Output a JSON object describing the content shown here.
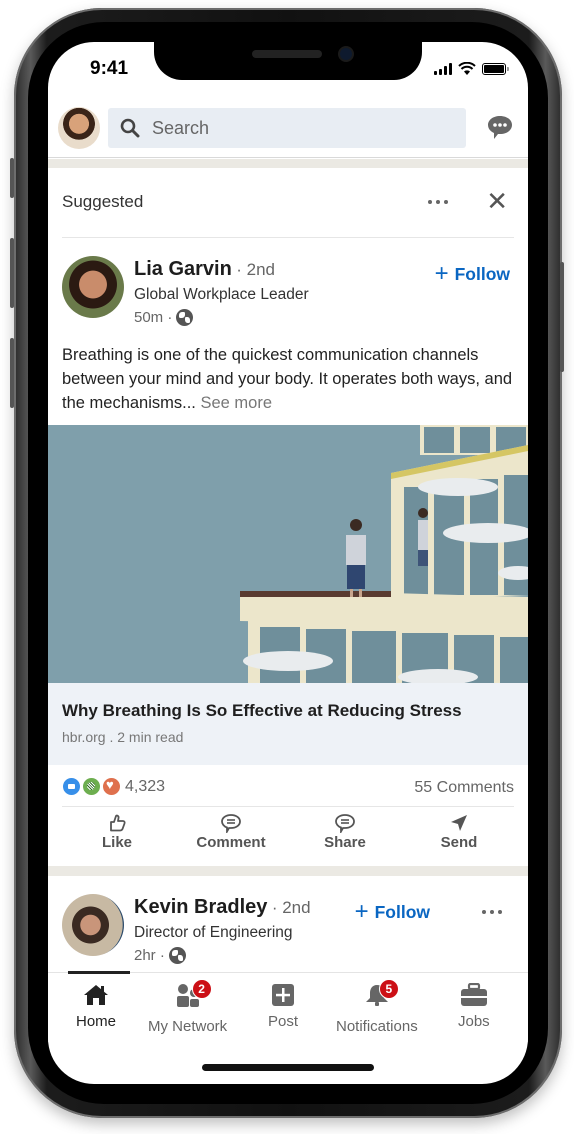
{
  "status_bar": {
    "time": "9:41"
  },
  "top_bar": {
    "search_placeholder": "Search"
  },
  "feed": {
    "post1": {
      "section_label": "Suggested",
      "author": {
        "name": "Lia Garvin",
        "degree": "· 2nd",
        "headline": "Global Workplace Leader",
        "time": "50m ·"
      },
      "follow_label": "Follow",
      "text": "Breathing is one of the quickest communication channels between your mind and your body. It operates both ways, and the mechanisms...",
      "see_more": "See more",
      "link": {
        "title": "Why Breathing Is So Effective at Reducing Stress",
        "meta": "hbr.org . 2 min read"
      },
      "reactions": {
        "icons": [
          "like-icon",
          "celebrate-icon",
          "love-icon"
        ],
        "count": "4,323"
      },
      "comments": "55 Comments",
      "actions": [
        {
          "label": "Like",
          "icon": "thumbs-up-icon"
        },
        {
          "label": "Comment",
          "icon": "comment-icon"
        },
        {
          "label": "Share",
          "icon": "share-icon"
        },
        {
          "label": "Send",
          "icon": "send-icon"
        }
      ]
    },
    "post2": {
      "author": {
        "name": "Kevin Bradley",
        "degree": "· 2nd",
        "headline": "Director of Engineering",
        "time": "2hr ·"
      },
      "follow_label": "Follow"
    }
  },
  "bottom_nav": {
    "items": [
      {
        "label": "Home",
        "icon": "home-icon",
        "active": true
      },
      {
        "label": "My Network",
        "icon": "network-icon",
        "badge": "2"
      },
      {
        "label": "Post",
        "icon": "post-icon"
      },
      {
        "label": "Notifications",
        "icon": "bell-icon",
        "badge": "5"
      },
      {
        "label": "Jobs",
        "icon": "briefcase-icon"
      }
    ]
  },
  "colors": {
    "accent": "#0a66c2",
    "badge": "#cc1016",
    "search_bg": "#e8edf3",
    "feed_gap": "#ebe9e3"
  }
}
